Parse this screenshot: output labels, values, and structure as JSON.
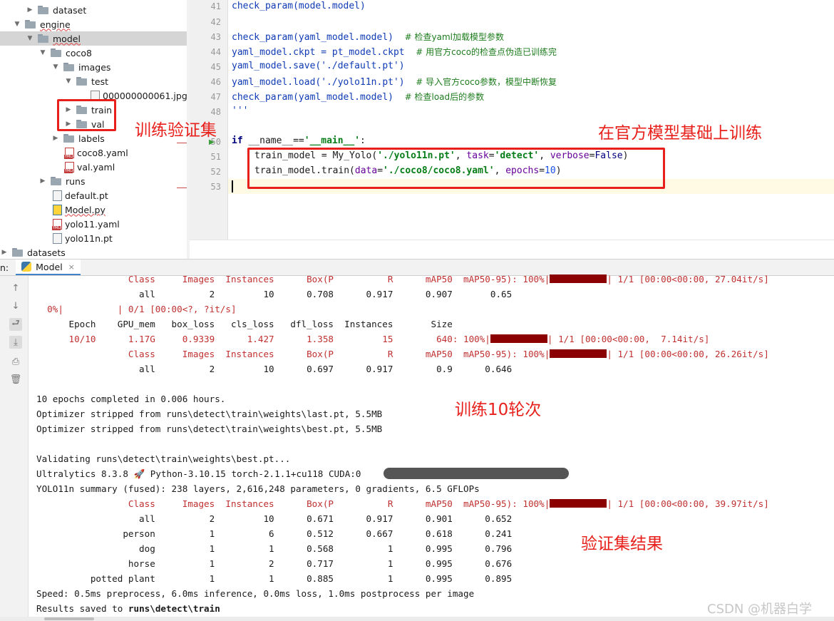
{
  "tree": {
    "items": [
      {
        "label": "dataset",
        "icon": "folder-icon",
        "arrow": "▶"
      },
      {
        "label": "engine",
        "icon": "folder-icon",
        "arrow": "▼"
      },
      {
        "label": "model",
        "icon": "folder-icon",
        "arrow": "▼"
      },
      {
        "label": "coco8",
        "icon": "folder-icon",
        "arrow": "▼"
      },
      {
        "label": "images",
        "icon": "folder-icon",
        "arrow": "▼"
      },
      {
        "label": "test",
        "icon": "folder-icon",
        "arrow": "▼"
      },
      {
        "label": "000000000061.jpg",
        "icon": "image-file-icon",
        "arrow": ""
      },
      {
        "label": "train",
        "icon": "folder-icon",
        "arrow": "▶"
      },
      {
        "label": "val",
        "icon": "folder-icon",
        "arrow": "▶"
      },
      {
        "label": "labels",
        "icon": "folder-icon",
        "arrow": "▶"
      },
      {
        "label": "coco8.yaml",
        "icon": "yaml-file-icon",
        "arrow": ""
      },
      {
        "label": "val.yaml",
        "icon": "yaml-file-icon",
        "arrow": ""
      },
      {
        "label": "runs",
        "icon": "folder-icon",
        "arrow": "▶"
      },
      {
        "label": "default.pt",
        "icon": "pt-file-icon",
        "arrow": ""
      },
      {
        "label": "Model.py",
        "icon": "python-file-icon",
        "arrow": ""
      },
      {
        "label": "yolo11.yaml",
        "icon": "yaml-file-icon",
        "arrow": ""
      },
      {
        "label": "yolo11n.pt",
        "icon": "pt-file-icon",
        "arrow": ""
      },
      {
        "label": "datasets",
        "icon": "folder-icon",
        "arrow": "▶"
      }
    ]
  },
  "editor": {
    "line_numbers": [
      "41",
      "42",
      "43",
      "44",
      "45",
      "46",
      "47",
      "48",
      "50",
      "51",
      "52",
      "53"
    ],
    "lines": {
      "l41": "check_param(model.model)",
      "l43_code": "check_param(yaml_model.model)",
      "l43_cmt": "# 检查yaml加载模型参数",
      "l44_code": "yaml_model.ckpt = pt_model.ckpt",
      "l44_cmt": "# 用官方coco的检查点伪造已训练完",
      "l45": "yaml_model.save('./default.pt')",
      "l46_code": "yaml_model.load('./yolo11n.pt')",
      "l46_cmt": "# 导入官方coco参数，模型中断恢复",
      "l47_code": "check_param(yaml_model.model)",
      "l47_cmt": "# 检查load后的参数",
      "l48": "'''",
      "l50_kw": "if",
      "l50_name": "__name__",
      "l50_eq": "==",
      "l50_str": "'__main__'",
      "l50_colon": ":",
      "l51_a": "train_model = My_Yolo(",
      "l51_str": "'./yolo11n.pt'",
      "l51_b": ", ",
      "l51_p1": "task",
      "l51_c": "=",
      "l51_str2": "'detect'",
      "l51_d": ", ",
      "l51_p2": "verbose",
      "l51_e": "=",
      "l51_const": "False",
      "l51_f": ")",
      "l52_a": "train_model.train(",
      "l52_p1": "data",
      "l52_b": "=",
      "l52_str": "'./coco8/coco8.yaml'",
      "l52_c": ", ",
      "l52_p2": "epochs",
      "l52_d": "=",
      "l52_num": "10",
      "l52_e": ")"
    }
  },
  "run": {
    "prefix": "n:",
    "tab_label": "Model",
    "close_glyph": "×"
  },
  "console": {
    "lines": [
      "                 Class     Images  Instances      Box(P          R      mAP50  mAP50-95): 100%|",
      "                   all          2         10      0.708      0.917      0.907       0.65",
      "  0%|          | 0/1 [00:00<?, ?it/s]",
      "      Epoch    GPU_mem   box_loss   cls_loss   dfl_loss  Instances       Size",
      "      10/10      1.17G     0.9339      1.427      1.358         15        640: 100%|",
      "                 Class     Images  Instances      Box(P          R      mAP50  mAP50-95): 100%|",
      "                   all          2         10      0.697      0.917        0.9      0.646",
      "",
      "10 epochs completed in 0.006 hours.",
      "Optimizer stripped from runs\\detect\\train\\weights\\last.pt, 5.5MB",
      "Optimizer stripped from runs\\detect\\train\\weights\\best.pt, 5.5MB",
      "",
      "Validating runs\\detect\\train\\weights\\best.pt...",
      "Ultralytics 8.3.8 🚀 Python-3.10.15 torch-2.1.1+cu118 CUDA:0",
      "YOLO11n summary (fused): 238 layers, 2,616,248 parameters, 0 gradients, 6.5 GFLOPs",
      "                 Class     Images  Instances      Box(P          R      mAP50  mAP50-95): 100%|",
      "                   all          2         10      0.671      0.917      0.901      0.652",
      "                person          1          6      0.512      0.667      0.618      0.241",
      "                   dog          1          1      0.568          1      0.995      0.796",
      "                 horse          1          2      0.717          1      0.995      0.676",
      "          potted plant          1          1      0.885          1      0.995      0.895",
      "Speed: 0.5ms preprocess, 6.0ms inference, 0.0ms loss, 1.0ms postprocess per image",
      "Results saved to runs\\detect\\train"
    ],
    "tails": {
      "t0": "| 1/1 [00:00<00:00, 27.04it/s]",
      "t4": "| 1/1 [00:00<00:00,  7.14it/s]",
      "t5": "| 1/1 [00:00<00:00, 26.26it/s]",
      "t15": "| 1/1 [00:00<00:00, 39.97it/s]"
    },
    "results_prefix": "Results saved to ",
    "results_path": "runs\\detect\\train"
  },
  "annotations": {
    "train_val": "训练验证集",
    "official": "在官方模型基础上训练",
    "epochs": "训练10轮次",
    "val_result": "验证集结果"
  },
  "watermark": "CSDN @机器白学",
  "colors": {
    "annotation": "#e8201c",
    "progress_bar": "#8b0000",
    "selection": "#d5d5d5"
  }
}
